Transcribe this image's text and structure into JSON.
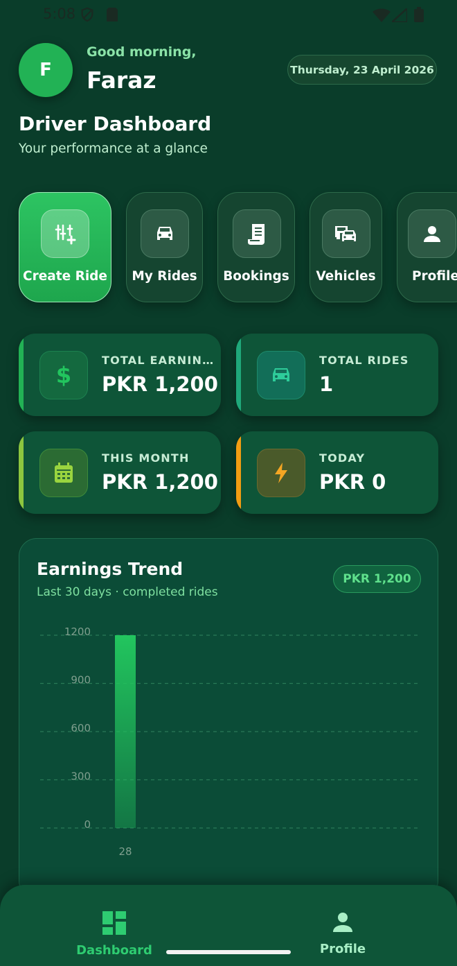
{
  "status_bar": {
    "time": "5:08"
  },
  "header": {
    "avatar_initial": "F",
    "greeting": "Good morning,",
    "name": "Faraz",
    "date": "Thursday, 23 April 2026"
  },
  "page": {
    "title": "Driver Dashboard",
    "subtitle": "Your performance at a glance"
  },
  "quick_actions": [
    {
      "label": "Create Ride",
      "icon": "create-ride-icon",
      "active": true
    },
    {
      "label": "My Rides",
      "icon": "car-icon"
    },
    {
      "label": "Bookings",
      "icon": "receipt-icon"
    },
    {
      "label": "Vehicles",
      "icon": "vehicles-icon"
    },
    {
      "label": "Profile",
      "icon": "person-icon"
    }
  ],
  "stats": [
    {
      "label": "TOTAL EARNIN…",
      "value": "PKR 1,200",
      "icon": "dollar-icon",
      "accent": "#22b255"
    },
    {
      "label": "TOTAL RIDES",
      "value": "1",
      "icon": "car-icon",
      "accent": "#1fa87a"
    },
    {
      "label": "THIS MONTH",
      "value": "PKR 1,200",
      "icon": "calendar-icon",
      "accent": "#8cc63f"
    },
    {
      "label": "TODAY",
      "value": "PKR 0",
      "icon": "lightning-icon",
      "accent": "#f39c12"
    }
  ],
  "earnings_card": {
    "title": "Earnings Trend",
    "subtitle": "Last 30 days · completed rides",
    "badge": "PKR 1,200"
  },
  "chart_data": {
    "type": "bar",
    "categories": [
      "28"
    ],
    "values": [
      1200
    ],
    "ylim": [
      0,
      1200
    ],
    "yticks": [
      0,
      300,
      600,
      900,
      1200
    ],
    "grid": true,
    "bar_color": "#22c55e"
  },
  "bottom_nav": [
    {
      "label": "Dashboard",
      "icon": "dashboard-icon",
      "active": true
    },
    {
      "label": "Profile",
      "icon": "person-icon"
    }
  ],
  "colors": {
    "background": "#0a3d2a",
    "card": "#0e5538",
    "accent": "#22b255",
    "accent_text": "#5fe08c"
  }
}
